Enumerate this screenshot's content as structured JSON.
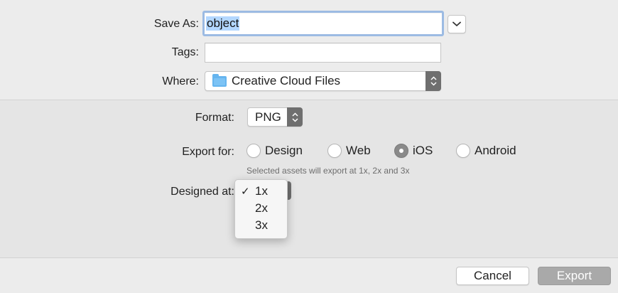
{
  "save_as": {
    "label": "Save As:",
    "value": "object"
  },
  "tags": {
    "label": "Tags:",
    "value": ""
  },
  "where": {
    "label": "Where:",
    "value": "Creative Cloud Files",
    "icon": "folder-icon"
  },
  "format": {
    "label": "Format:",
    "value": "PNG"
  },
  "export_for": {
    "label": "Export for:",
    "options": [
      "Design",
      "Web",
      "iOS",
      "Android"
    ],
    "selected": "iOS",
    "hint": "Selected assets will export at 1x, 2x and 3x"
  },
  "designed_at": {
    "label": "Designed at:",
    "options": [
      "1x",
      "2x",
      "3x"
    ],
    "selected": "1x",
    "check_glyph": "✓"
  },
  "buttons": {
    "cancel": "Cancel",
    "export": "Export"
  },
  "colors": {
    "selection": "#b3d7ff",
    "focus_ring": "#9cbbe3",
    "folder": "#66b5ef",
    "disabled_button": "#a9a9a9"
  }
}
